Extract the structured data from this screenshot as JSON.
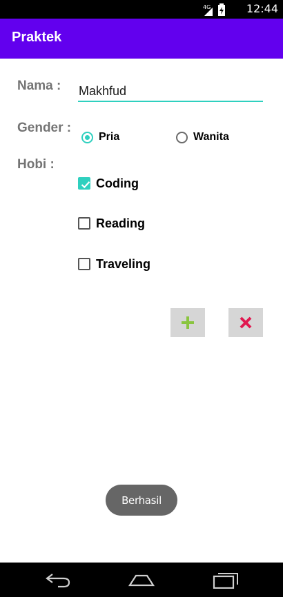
{
  "status_bar": {
    "network": "4G",
    "time": "12:44"
  },
  "app_bar": {
    "title": "Praktek"
  },
  "form": {
    "nama_label": "Nama :",
    "nama_value": "Makhfud",
    "gender_label": "Gender :",
    "gender_options": [
      {
        "label": "Pria",
        "checked": true
      },
      {
        "label": "Wanita",
        "checked": false
      }
    ],
    "hobi_label": "Hobi :",
    "hobi_options": [
      {
        "label": "Coding",
        "checked": true
      },
      {
        "label": "Reading",
        "checked": false
      },
      {
        "label": "Traveling",
        "checked": false
      }
    ]
  },
  "actions": {
    "add_icon": "plus-icon",
    "cancel_icon": "close-icon",
    "add_color": "#8ac53f",
    "cancel_color": "#e0184f"
  },
  "toast": {
    "message": "Berhasil"
  },
  "nav": {
    "back_icon": "back-icon",
    "home_icon": "home-icon",
    "recent_icon": "recents-icon"
  },
  "colors": {
    "primary": "#6200ee",
    "accent": "#2fd0bf"
  }
}
